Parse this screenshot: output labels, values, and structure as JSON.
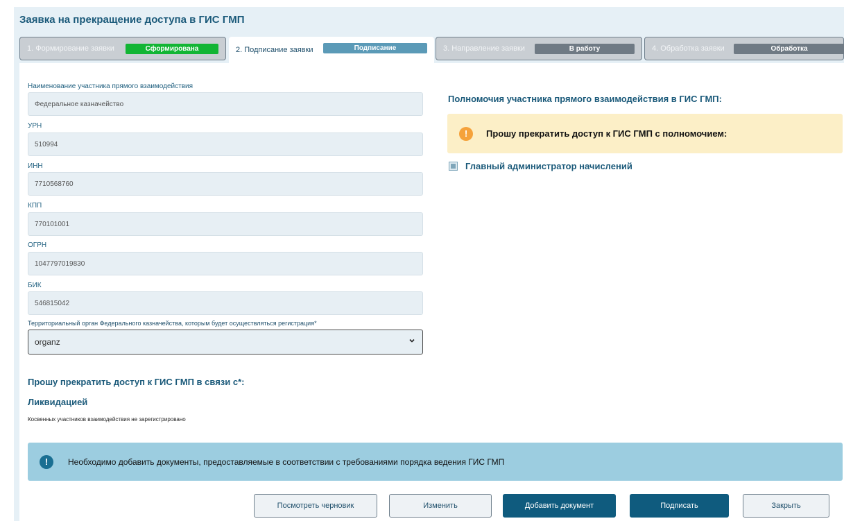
{
  "page": {
    "title": "Заявка на прекращение доступа в ГИС ГМП"
  },
  "steps": [
    {
      "label": "1. Формирование заявки",
      "badge": "Сформирована",
      "badge_color": "#12b534"
    },
    {
      "label": "2. Подписание заявки",
      "badge": "Подписание",
      "badge_color": "#5b9ab7"
    },
    {
      "label": "3. Направление заявки",
      "badge": "В работу",
      "badge_color": "#6f7a84"
    },
    {
      "label": "4. Обработка заявки",
      "badge": "Обработка",
      "badge_color": "#6f7a84"
    }
  ],
  "form": {
    "fields": [
      {
        "label": "Наименование участника прямого взаимодействия",
        "value": "Федеральное казначейство"
      },
      {
        "label": "УРН",
        "value": "510994"
      },
      {
        "label": "ИНН",
        "value": "7710568760"
      },
      {
        "label": "КПП",
        "value": "770101001"
      },
      {
        "label": "ОГРН",
        "value": "1047797019830"
      },
      {
        "label": "БИК",
        "value": "546815042"
      }
    ],
    "select_label": "Территориальный орган Федерального казначейства, которым будет осуществляться регистрация*",
    "select_value": "organz"
  },
  "reason": {
    "title": "Прошу прекратить доступ к ГИС ГМП в связи с*:",
    "value": "Ликвидацией",
    "note": "Косвенных участников взаимодействия не зарегистрировано"
  },
  "powers": {
    "title": "Полномочия участника прямого взаимодействия в ГИС ГМП:",
    "warning": "Прошу прекратить доступ к ГИС ГМП с полномочием:",
    "items": [
      {
        "label": "Главный администратор начислений",
        "checked": true
      }
    ]
  },
  "info": {
    "text": "Необходимо добавить документы, предоставляемые в соответствии с требованиями порядка ведения ГИС ГМП"
  },
  "buttons": {
    "view_draft": "Посмотреть черновик",
    "edit": "Изменить",
    "add_document": "Добавить документ",
    "sign": "Подписать",
    "close": "Закрыть"
  },
  "colors": {
    "accent": "#0f5b7e",
    "warning_bg": "#fcefc7",
    "info_bg": "#9ccde0"
  },
  "icons": {
    "warning": "exclamation-circle-icon",
    "info": "exclamation-circle-icon",
    "select": "chevron-down-icon"
  }
}
